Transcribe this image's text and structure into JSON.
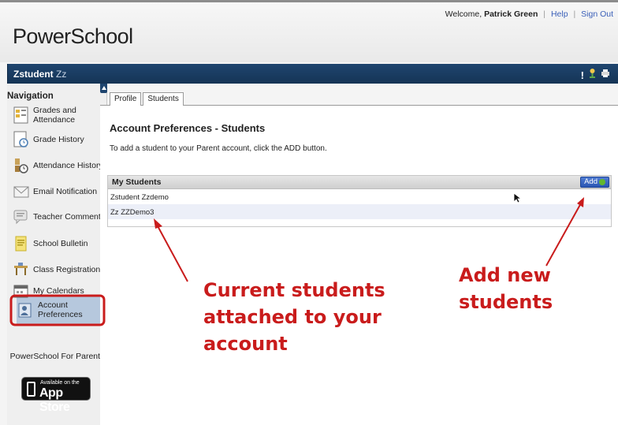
{
  "header": {
    "logo": "PowerSchool",
    "welcome_prefix": "Welcome,",
    "user_name": "Patrick Green",
    "help_label": "Help",
    "signout_label": "Sign Out"
  },
  "student_bar": {
    "first": "Zstudent",
    "last": "Zz"
  },
  "sidebar": {
    "title": "Navigation",
    "items": [
      {
        "label": "Grades and Attendance",
        "icon": "grades-icon"
      },
      {
        "label": "Grade History",
        "icon": "grade-history-icon"
      },
      {
        "label": "Attendance History",
        "icon": "attendance-history-icon"
      },
      {
        "label": "Email Notification",
        "icon": "email-icon"
      },
      {
        "label": "Teacher Comments",
        "icon": "comments-icon"
      },
      {
        "label": "School Bulletin",
        "icon": "bulletin-icon"
      },
      {
        "label": "Class Registration",
        "icon": "registration-icon"
      },
      {
        "label": "My Calendars",
        "icon": "calendar-icon"
      },
      {
        "label": "Account Preferences",
        "icon": "account-icon"
      }
    ],
    "promo": "PowerSchool For Parents",
    "app_store_small": "Available on the",
    "app_store_big": "App Store"
  },
  "tabs": [
    {
      "label": "Profile"
    },
    {
      "label": "Students"
    }
  ],
  "main": {
    "title": "Account Preferences - Students",
    "instruction": "To add a student to your Parent account, click the ADD button.",
    "panel_title": "My Students",
    "add_label": "Add",
    "students": [
      "Zstudent Zzdemo",
      "Zz ZZDemo3"
    ]
  },
  "annotations": {
    "current": "Current students attached to your account",
    "add_new": "Add new students"
  },
  "colors": {
    "bar": "#1f456f",
    "annotation": "#c91c1c",
    "add_button": "#2a56b3"
  }
}
